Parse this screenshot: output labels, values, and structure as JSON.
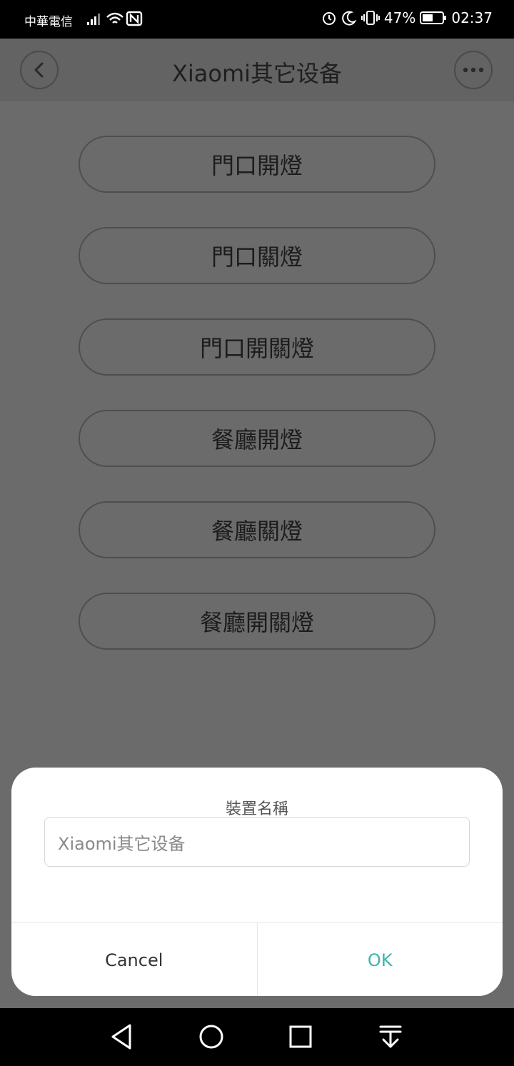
{
  "status_bar": {
    "carrier": "中華電信",
    "battery": "47%",
    "time": "02:37"
  },
  "header": {
    "title": "Xiaomi其它设备",
    "back_icon": "chevron-left-icon",
    "more_icon": "more-dots-icon"
  },
  "commands": [
    {
      "label": "門口開燈"
    },
    {
      "label": "門口關燈"
    },
    {
      "label": "門口開關燈"
    },
    {
      "label": "餐廳開燈"
    },
    {
      "label": "餐廳關燈"
    },
    {
      "label": "餐廳開關燈"
    }
  ],
  "dialog": {
    "title": "裝置名稱",
    "input_value": "Xiaomi其它设备",
    "cancel_label": "Cancel",
    "ok_label": "OK",
    "ok_color": "#3fb3b0"
  },
  "nav_bar": {
    "icons": [
      "back-icon",
      "home-icon",
      "recents-icon",
      "notification-pull-icon"
    ]
  }
}
